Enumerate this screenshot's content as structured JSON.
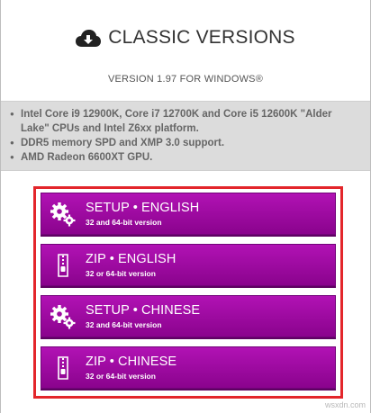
{
  "header": {
    "title": "CLASSIC VERSIONS",
    "version": "VERSION 1.97 FOR WINDOWS®",
    "icon": "cloud-download-icon"
  },
  "notes": [
    "Intel Core i9 12900K, Core i7 12700K and Core i5 12600K \"Alder Lake\" CPUs and Intel Z6xx platform.",
    "DDR5 memory SPD and XMP 3.0 support.",
    "AMD Radeon 6600XT GPU."
  ],
  "downloads": [
    {
      "label": "SETUP • ENGLISH",
      "sub": "32 and 64-bit version",
      "icon": "gears-icon"
    },
    {
      "label": "ZIP • ENGLISH",
      "sub": "32 or 64-bit version",
      "icon": "zip-file-icon"
    },
    {
      "label": "SETUP • CHINESE",
      "sub": "32 and 64-bit version",
      "icon": "gears-icon"
    },
    {
      "label": "ZIP • CHINESE",
      "sub": "32 or 64-bit version",
      "icon": "zip-file-icon"
    }
  ],
  "colors": {
    "button": "#9c0aa0",
    "highlight_border": "#e3262b",
    "notes_bg": "#dcdcdc"
  },
  "watermark": "wsxdn.com"
}
